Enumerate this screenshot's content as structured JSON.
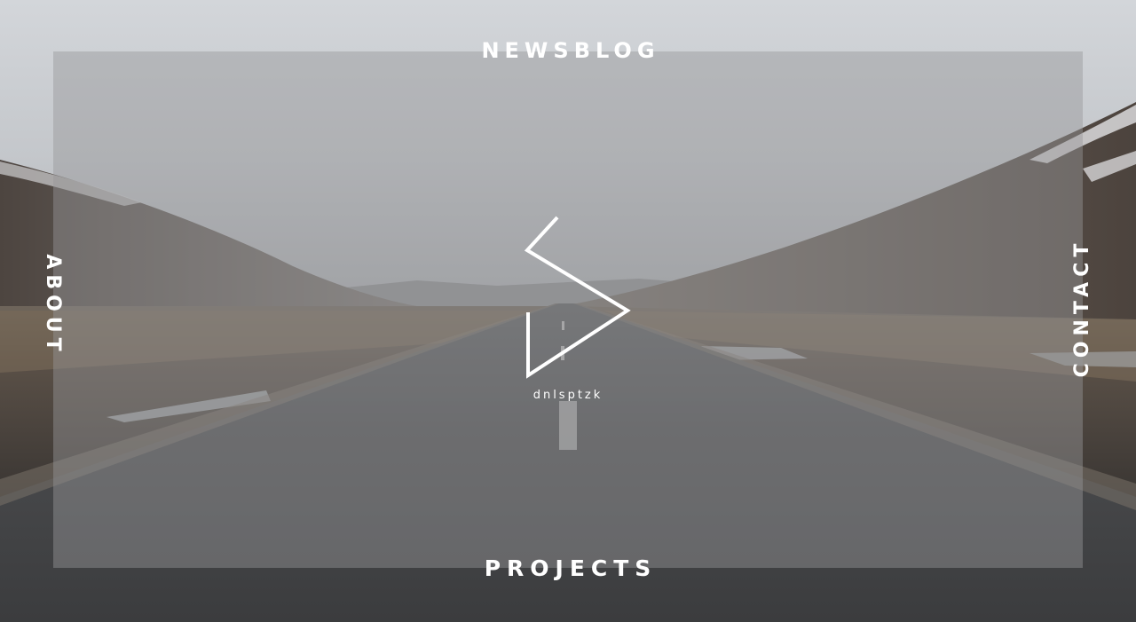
{
  "nav": {
    "top_label": "NEWSBLOG",
    "left_label": "ABOUT",
    "right_label": "CONTACT",
    "bottom_label": "PROJECTS"
  },
  "brand": {
    "name": "dnlsptzk",
    "logo_icon": "play-s-monogram-icon"
  },
  "colors": {
    "nav_text": "#ffffff",
    "overlay": "#969698"
  }
}
